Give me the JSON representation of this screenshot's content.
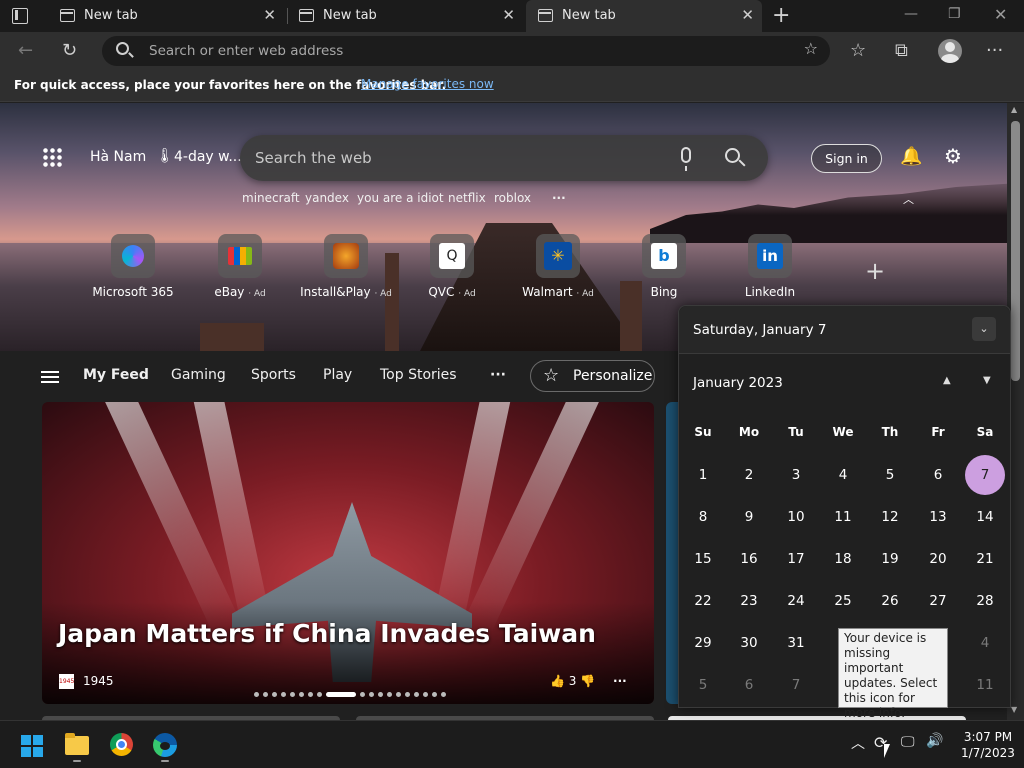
{
  "browser": {
    "tabs": [
      {
        "label": "New tab",
        "active": false
      },
      {
        "label": "New tab",
        "active": false
      },
      {
        "label": "New tab",
        "active": true
      }
    ],
    "address_placeholder": "Search or enter web address",
    "favorites_bar": {
      "text": "For quick access, place your favorites here on the favorites bar.",
      "link": "Manage favorites now"
    }
  },
  "newtab": {
    "location": "Hà Nam",
    "forecast": "4-day w...",
    "search_placeholder": "Search the web",
    "trending": [
      "minecraft",
      "yandex",
      "you are a idiot",
      "netflix",
      "roblox"
    ],
    "more": "···",
    "signin": "Sign in",
    "quick_links": [
      {
        "label": "Microsoft 365",
        "ad": ""
      },
      {
        "label": "eBay",
        "ad": "· Ad"
      },
      {
        "label": "Install&Play",
        "ad": "· Ad"
      },
      {
        "label": "QVC",
        "ad": "· Ad"
      },
      {
        "label": "Walmart",
        "ad": "· Ad"
      },
      {
        "label": "Bing",
        "ad": ""
      },
      {
        "label": "LinkedIn",
        "ad": ""
      }
    ],
    "feed_nav": [
      "My Feed",
      "Gaming",
      "Sports",
      "Play",
      "Top Stories"
    ],
    "feed_more": "···",
    "personalize": "Personalize",
    "card": {
      "headline": "Japan Matters if China Invades Taiwan",
      "source": "1945",
      "source_icon": "1945",
      "likes": "3",
      "slide_count": 19,
      "active_slide": 8
    }
  },
  "calendar": {
    "selected_date": "Saturday, January 7",
    "month": "January 2023",
    "weekdays": [
      "Su",
      "Mo",
      "Tu",
      "We",
      "Th",
      "Fr",
      "Sa"
    ],
    "weeks": [
      [
        "1",
        "2",
        "3",
        "4",
        "5",
        "6",
        "7"
      ],
      [
        "8",
        "9",
        "10",
        "11",
        "12",
        "13",
        "14"
      ],
      [
        "15",
        "16",
        "17",
        "18",
        "19",
        "20",
        "21"
      ],
      [
        "22",
        "23",
        "24",
        "25",
        "26",
        "27",
        "28"
      ],
      [
        "29",
        "30",
        "31",
        "",
        "",
        "",
        "4"
      ],
      [
        "5",
        "6",
        "7",
        "",
        "",
        "",
        "11"
      ]
    ],
    "today": "7"
  },
  "tooltip": "Your device is missing important updates. Select this icon for more info.",
  "taskbar": {
    "time": "3:07 PM",
    "date": "1/7/2023"
  },
  "colors": {
    "accent_today": "#cc9fe0",
    "link": "#7ab8f5",
    "windows_blue": "#28a8ea"
  }
}
